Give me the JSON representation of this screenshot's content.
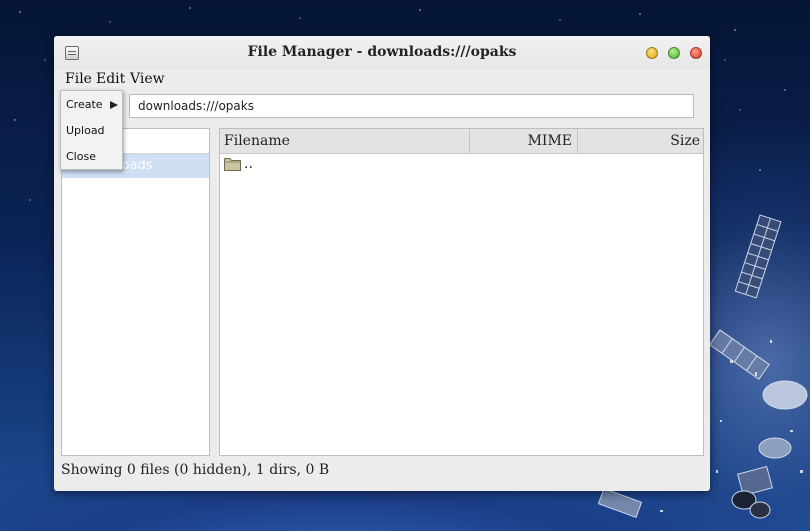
{
  "window": {
    "title": "File Manager - downloads:///opaks",
    "icon": "window-menu-icon"
  },
  "window_controls": [
    "minimize-button",
    "maximize-button",
    "close-button"
  ],
  "menubar": {
    "file": "File",
    "edit": "Edit",
    "view": "View"
  },
  "file_menu": {
    "items": [
      {
        "label": "Create",
        "icon": "submenu-arrow-icon"
      },
      {
        "label": "Upload"
      },
      {
        "label": "Close"
      }
    ]
  },
  "path_bar": {
    "value": "downloads:///opaks"
  },
  "sidebar": {
    "items": [
      {
        "label": "loads",
        "selected": true
      }
    ]
  },
  "file_list": {
    "columns": {
      "filename": "Filename",
      "mime": "MIME",
      "size": "Size"
    },
    "rows": [
      {
        "name": "..",
        "icon": "folder-icon"
      }
    ]
  },
  "status": {
    "text": "Showing 0 files (0 hidden), 1 dirs, 0 B"
  },
  "colors": {
    "selection": "#cfdff4",
    "window_bg": "#ececec",
    "header_bg": "#e3e3e3"
  }
}
